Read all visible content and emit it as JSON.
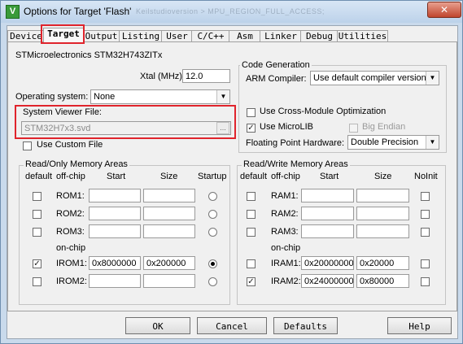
{
  "window": {
    "title": "Options for Target 'Flash'",
    "ghost_title": "Keilstudioversion > MPU_REGION_FULL_ACCESS;",
    "close": "✕"
  },
  "tabs": [
    "Device",
    "Target",
    "Output",
    "Listing",
    "User",
    "C/C++",
    "Asm",
    "Linker",
    "Debug",
    "Utilities"
  ],
  "active_tab": "Target",
  "device": "STMicroelectronics STM32H743ZITx",
  "xtal": {
    "label": "Xtal (MHz):",
    "value": "12.0"
  },
  "os": {
    "label": "Operating system:",
    "value": "None"
  },
  "svd": {
    "label": "System Viewer File:",
    "value": "STM32H7x3.svd",
    "browse": "..."
  },
  "custom_file": {
    "label": "Use Custom File",
    "checked": false
  },
  "code_gen": {
    "title": "Code Generation",
    "compiler_label": "ARM Compiler:",
    "compiler_value": "Use default compiler version 5",
    "cross_module": {
      "label": "Use Cross-Module Optimization",
      "checked": false
    },
    "microlib": {
      "label": "Use MicroLIB",
      "checked": true
    },
    "big_endian": {
      "label": "Big Endian",
      "checked": false,
      "enabled": false
    },
    "fp_label": "Floating Point Hardware:",
    "fp_value": "Double Precision"
  },
  "ro_memory": {
    "title": "Read/Only Memory Areas",
    "headers": {
      "default": "default",
      "offchip": "off-chip",
      "start": "Start",
      "size": "Size",
      "startup": "Startup"
    },
    "onchip_label": "on-chip",
    "rows": [
      {
        "name": "ROM1:",
        "default": false,
        "start": "",
        "size": "",
        "startup": false
      },
      {
        "name": "ROM2:",
        "default": false,
        "start": "",
        "size": "",
        "startup": false
      },
      {
        "name": "ROM3:",
        "default": false,
        "start": "",
        "size": "",
        "startup": false
      },
      {
        "name": "IROM1:",
        "default": true,
        "start": "0x8000000",
        "size": "0x200000",
        "startup": true
      },
      {
        "name": "IROM2:",
        "default": false,
        "start": "",
        "size": "",
        "startup": false
      }
    ]
  },
  "rw_memory": {
    "title": "Read/Write Memory Areas",
    "headers": {
      "default": "default",
      "offchip": "off-chip",
      "start": "Start",
      "size": "Size",
      "noinit": "NoInit"
    },
    "onchip_label": "on-chip",
    "rows": [
      {
        "name": "RAM1:",
        "default": false,
        "start": "",
        "size": "",
        "noinit": false
      },
      {
        "name": "RAM2:",
        "default": false,
        "start": "",
        "size": "",
        "noinit": false
      },
      {
        "name": "RAM3:",
        "default": false,
        "start": "",
        "size": "",
        "noinit": false
      },
      {
        "name": "IRAM1:",
        "default": false,
        "start": "0x20000000",
        "size": "0x20000",
        "noinit": false
      },
      {
        "name": "IRAM2:",
        "default": true,
        "start": "0x24000000",
        "size": "0x80000",
        "noinit": false
      }
    ]
  },
  "buttons": {
    "ok": "OK",
    "cancel": "Cancel",
    "defaults": "Defaults",
    "help": "Help"
  },
  "colors": {
    "highlight": "#e0242c",
    "title_bar": "#bcd2ea",
    "panel": "#f0f0f0"
  }
}
